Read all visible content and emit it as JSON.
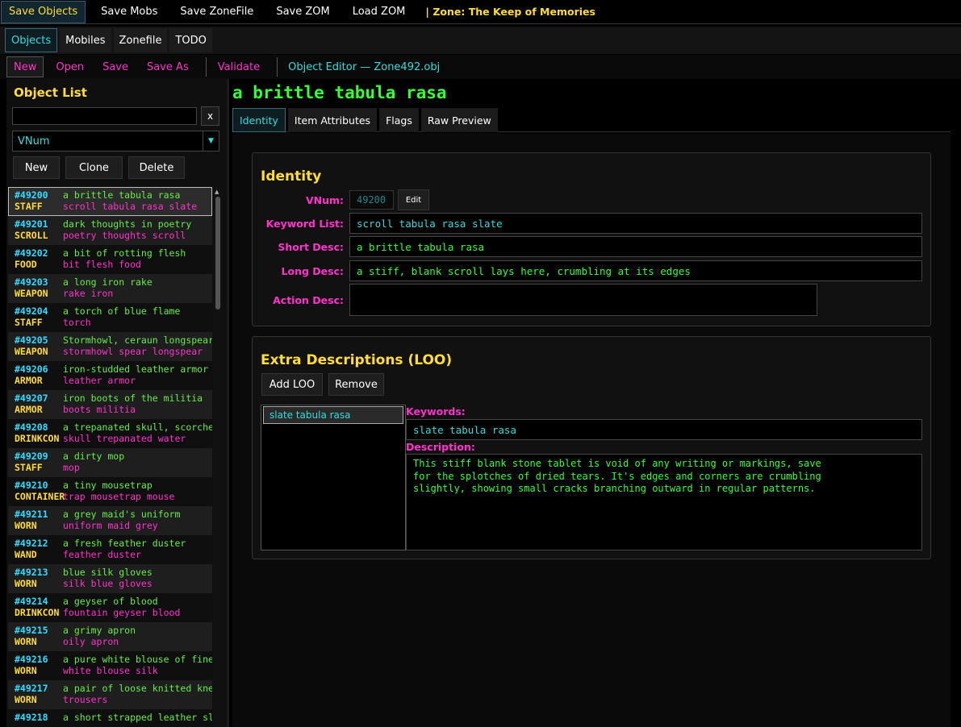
{
  "topbar": {
    "buttons": [
      "Save Objects",
      "Save Mobs",
      "Save ZoneFile",
      "Save ZOM",
      "Load ZOM"
    ],
    "zone_label": "| Zone: The Keep of Memories"
  },
  "tabs": [
    "Objects",
    "Mobiles",
    "Zonefile",
    "TODO"
  ],
  "actions": {
    "new": "New",
    "open": "Open",
    "save": "Save",
    "save_as": "Save As",
    "validate": "Validate",
    "editor_title": "Object Editor — Zone492.obj"
  },
  "object_list": {
    "title": "Object List",
    "search_value": "",
    "clear": "x",
    "sort_select": "VNum",
    "buttons": {
      "new": "New",
      "clone": "Clone",
      "delete": "Delete"
    },
    "rows": [
      {
        "vnum": "#49200",
        "type": "STAFF",
        "short": "a brittle tabula rasa",
        "keywords": "scroll tabula rasa slate"
      },
      {
        "vnum": "#49201",
        "type": "SCROLL",
        "short": "dark thoughts in poetry",
        "keywords": "poetry thoughts scroll"
      },
      {
        "vnum": "#49202",
        "type": "FOOD",
        "short": "a bit of rotting flesh",
        "keywords": "bit flesh food"
      },
      {
        "vnum": "#49203",
        "type": "WEAPON",
        "short": "a long iron rake",
        "keywords": "rake iron"
      },
      {
        "vnum": "#49204",
        "type": "STAFF",
        "short": "a torch of blue flame",
        "keywords": "torch"
      },
      {
        "vnum": "#49205",
        "type": "WEAPON",
        "short": "Stormhowl, ceraun longspear",
        "keywords": "stormhowl spear longspear"
      },
      {
        "vnum": "#49206",
        "type": "ARMOR",
        "short": "iron-studded leather armor",
        "keywords": "leather armor"
      },
      {
        "vnum": "#49207",
        "type": "ARMOR",
        "short": "iron boots of the militia",
        "keywords": "boots militia"
      },
      {
        "vnum": "#49208",
        "type": "DRINKCON",
        "short": "a trepanated skull, scorched",
        "keywords": "skull trepanated water"
      },
      {
        "vnum": "#49209",
        "type": "STAFF",
        "short": "a dirty mop",
        "keywords": "mop"
      },
      {
        "vnum": "#49210",
        "type": "CONTAINER",
        "short": "a tiny mousetrap",
        "keywords": "trap mousetrap mouse"
      },
      {
        "vnum": "#49211",
        "type": "WORN",
        "short": "a grey maid's uniform",
        "keywords": "uniform maid grey"
      },
      {
        "vnum": "#49212",
        "type": "WAND",
        "short": "a fresh feather duster",
        "keywords": "feather duster"
      },
      {
        "vnum": "#49213",
        "type": "WORN",
        "short": "blue silk gloves",
        "keywords": "silk blue gloves"
      },
      {
        "vnum": "#49214",
        "type": "DRINKCON",
        "short": "a geyser of blood",
        "keywords": "fountain geyser blood"
      },
      {
        "vnum": "#49215",
        "type": "WORN",
        "short": "a grimy apron",
        "keywords": "oily apron"
      },
      {
        "vnum": "#49216",
        "type": "WORN",
        "short": "a pure white blouse of fine",
        "keywords": "white blouse silk"
      },
      {
        "vnum": "#49217",
        "type": "WORN",
        "short": "a pair of loose knitted knee",
        "keywords": "trousers"
      },
      {
        "vnum": "#49218",
        "type": "",
        "short": "a short strapped leather sli",
        "keywords": ""
      }
    ]
  },
  "editor": {
    "object_title": "a brittle tabula rasa",
    "subtabs": [
      "Identity",
      "Item Attributes",
      "Flags",
      "Raw Preview"
    ],
    "identity": {
      "title": "Identity",
      "vnum_label": "VNum:",
      "vnum_value": "49200",
      "edit_button": "Edit",
      "keyword_label": "Keyword List:",
      "keyword_value": "scroll tabula rasa slate",
      "short_label": "Short Desc:",
      "short_value": "a brittle tabula rasa",
      "long_label": "Long Desc:",
      "long_value": "a stiff, blank scroll lays here, crumbling at its edges",
      "action_label": "Action Desc:",
      "action_value": ""
    },
    "extra": {
      "title": "Extra Descriptions (LOO)",
      "add_button": "Add LOO",
      "remove_button": "Remove",
      "items": [
        "slate tabula rasa"
      ],
      "keywords_label": "Keywords:",
      "keywords_value": "slate tabula rasa",
      "description_label": "Description:",
      "description_value": "This stiff blank stone tablet is void of any writing or markings, save\nfor the splotches of dried tears. It's edges and corners are crumbling\nslightly, showing small cracks branching outward in regular patterns."
    }
  },
  "colors": {
    "yellow": "#ffdd33",
    "cyan": "#33dddd",
    "green": "#33ff33",
    "magenta": "#ff33cc",
    "vnum_blue": "#33ddff"
  }
}
